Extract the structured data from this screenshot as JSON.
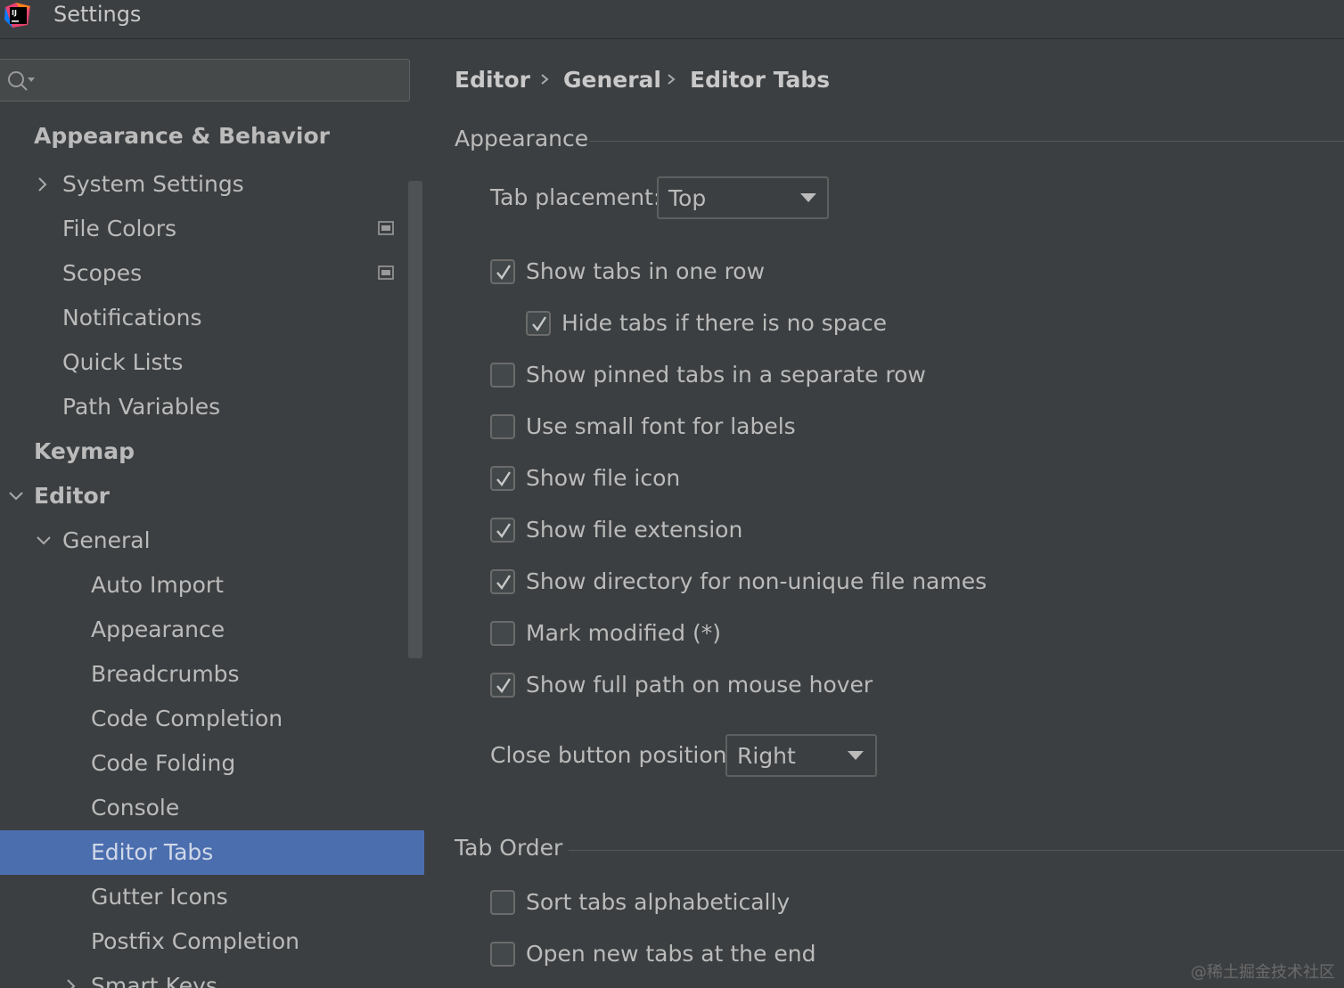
{
  "window": {
    "title": "Settings",
    "logo_text": "IJ"
  },
  "search": {
    "value": "",
    "placeholder": ""
  },
  "sidebar": {
    "items": [
      {
        "label": "Appearance & Behavior"
      },
      {
        "label": "System Settings"
      },
      {
        "label": "File Colors"
      },
      {
        "label": "Scopes"
      },
      {
        "label": "Notifications"
      },
      {
        "label": "Quick Lists"
      },
      {
        "label": "Path Variables"
      },
      {
        "label": "Keymap"
      },
      {
        "label": "Editor"
      },
      {
        "label": "General"
      },
      {
        "label": "Auto Import"
      },
      {
        "label": "Appearance"
      },
      {
        "label": "Breadcrumbs"
      },
      {
        "label": "Code Completion"
      },
      {
        "label": "Code Folding"
      },
      {
        "label": "Console"
      },
      {
        "label": "Editor Tabs"
      },
      {
        "label": "Gutter Icons"
      },
      {
        "label": "Postfix Completion"
      },
      {
        "label": "Smart Keys"
      }
    ],
    "selected": "Editor Tabs"
  },
  "breadcrumb": {
    "items": [
      "Editor",
      "General",
      "Editor Tabs"
    ]
  },
  "appearance": {
    "title": "Appearance",
    "tab_placement_label": "Tab placement:",
    "tab_placement_value": "Top",
    "checkboxes": [
      {
        "label": "Show tabs in one row",
        "checked": true
      },
      {
        "label": "Hide tabs if there is no space",
        "checked": true
      },
      {
        "label": "Show pinned tabs in a separate row",
        "checked": false
      },
      {
        "label": "Use small font for labels",
        "checked": false
      },
      {
        "label": "Show file icon",
        "checked": true
      },
      {
        "label": "Show file extension",
        "checked": true
      },
      {
        "label": "Show directory for non-unique file names",
        "checked": true
      },
      {
        "label": "Mark modified (*)",
        "checked": false
      },
      {
        "label": "Show full path on mouse hover",
        "checked": true
      }
    ],
    "close_button_label": "Close button position:",
    "close_button_value": "Right"
  },
  "tab_order": {
    "title": "Tab Order",
    "checkboxes": [
      {
        "label": "Sort tabs alphabetically",
        "checked": false
      },
      {
        "label": "Open new tabs at the end",
        "checked": false
      }
    ]
  },
  "watermark": "@稀土掘金技术社区",
  "colors": {
    "background": "#3c3f41",
    "selection": "#4b6eaf",
    "text": "#bbbbbb"
  }
}
